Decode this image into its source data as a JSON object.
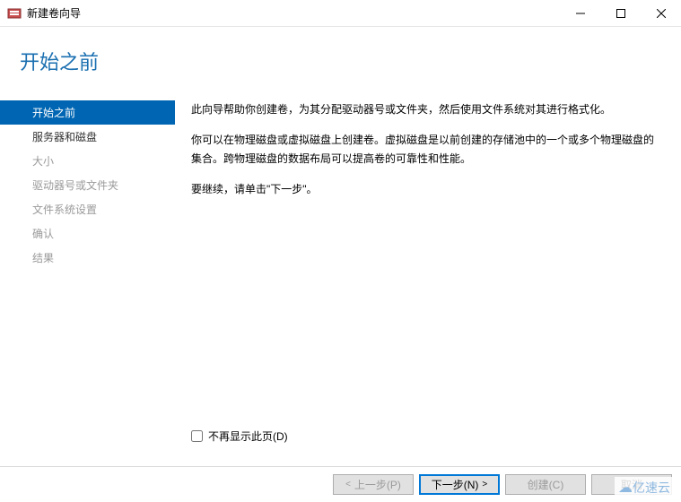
{
  "titlebar": {
    "title": "新建卷向导"
  },
  "header": {
    "title": "开始之前"
  },
  "sidebar": {
    "items": [
      {
        "label": "开始之前",
        "state": "active"
      },
      {
        "label": "服务器和磁盘",
        "state": "enabled"
      },
      {
        "label": "大小",
        "state": "disabled"
      },
      {
        "label": "驱动器号或文件夹",
        "state": "disabled"
      },
      {
        "label": "文件系统设置",
        "state": "disabled"
      },
      {
        "label": "确认",
        "state": "disabled"
      },
      {
        "label": "结果",
        "state": "disabled"
      }
    ]
  },
  "main": {
    "para1": "此向导帮助你创建卷，为其分配驱动器号或文件夹，然后使用文件系统对其进行格式化。",
    "para2": "你可以在物理磁盘或虚拟磁盘上创建卷。虚拟磁盘是以前创建的存储池中的一个或多个物理磁盘的集合。跨物理磁盘的数据布局可以提高卷的可靠性和性能。",
    "para3": "要继续，请单击\"下一步\"。"
  },
  "checkbox": {
    "label": "不再显示此页(D)"
  },
  "footer": {
    "prev": "上一步(P)",
    "next": "下一步(N)",
    "create": "创建(C)",
    "cancel": "取消"
  },
  "watermark": {
    "text": "亿速云"
  }
}
